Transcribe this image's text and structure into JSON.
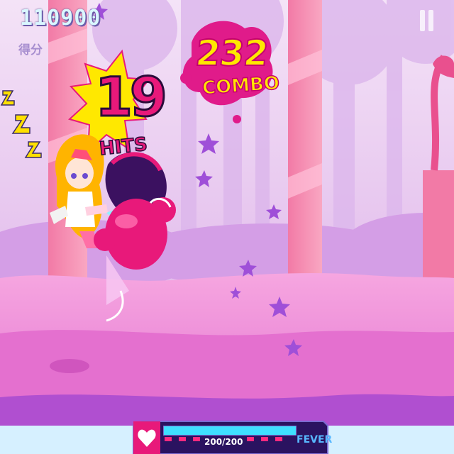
{
  "hud": {
    "score": "110900",
    "score_label": "得分",
    "pause_icon": "pause-icon"
  },
  "combo": {
    "count": "232",
    "label": "COMBO"
  },
  "hits": {
    "count": "19",
    "label": "HITS"
  },
  "status": {
    "hp_text": "200/200",
    "hp_fraction": 1.0,
    "fever_label": "FEVER",
    "fever_icon": "heart-icon"
  },
  "colors": {
    "sky": "#e7c8f0",
    "ground": "#ee8ad8",
    "accent_pink": "#e8197a",
    "combo_yellow": "#ffe800",
    "hp_cyan": "#3fe0ff"
  }
}
